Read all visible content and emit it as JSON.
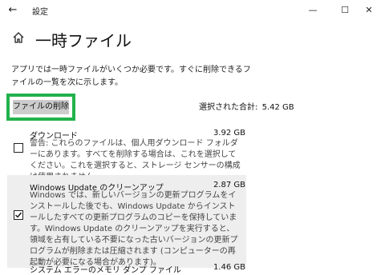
{
  "window": {
    "title": "設定",
    "back_glyph": "←",
    "minimize_glyph": "—",
    "maximize_glyph": "☐",
    "close_glyph": "✕"
  },
  "page": {
    "title": "一時ファイル",
    "intro": "アプリでは一時ファイルがいくつか必要です。すぐに削除できるファイルの一覧を次に示します。"
  },
  "actions": {
    "delete_label": "ファイルの削除",
    "selected_total_label": "選択された合計:",
    "selected_total_value": "5.42 GB"
  },
  "items": [
    {
      "title": "ダウンロード",
      "size": "3.92 GB",
      "checked": false,
      "description": "警告: これらのファイルは、個人用ダウンロード フォルダーにあります。すべてを削除する場合は、これを選択してください。これを選択すると、ストレージ センサーの構成は使用されません。"
    },
    {
      "title": "Windows Update のクリーンアップ",
      "size": "2.87 GB",
      "checked": true,
      "description": "Windows では、新しいバージョンの更新プログラムをインストールした後でも、Windows Update からインストールしたすべての更新プログラムのコピーを保持しています。Windows Update のクリーンアップを実行すると、領域を占有している不要になった古いバージョンの更新プログラムが削除または圧縮されます (コンピューターの再起動が必要になる場合があります)。"
    },
    {
      "title": "システム エラーのメモリ ダンプ ファイル",
      "size": "1.46 GB",
      "checked": false,
      "description": ""
    }
  ],
  "icons": {
    "home": "home-icon",
    "check": "checkmark-icon"
  },
  "colors": {
    "highlight_border": "#22b24c",
    "button_bg": "#cccccc",
    "selected_row_bg": "#eeeeee"
  }
}
